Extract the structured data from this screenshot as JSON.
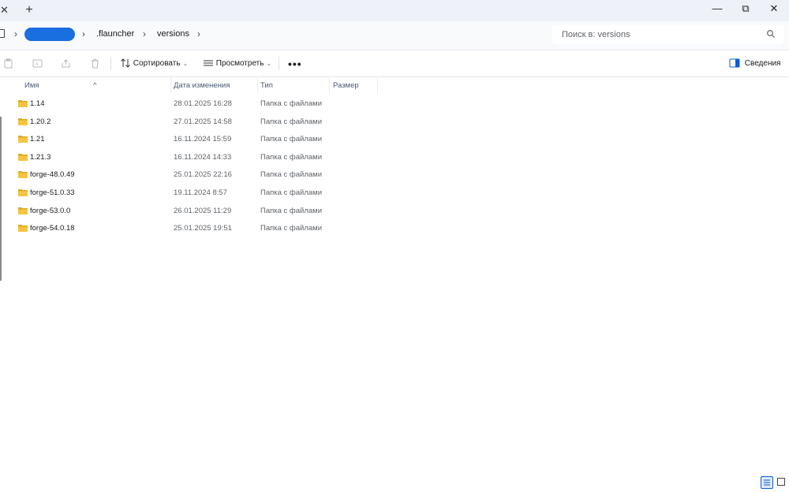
{
  "titlebar": {
    "tab_close": "✕",
    "new_tab": "+",
    "minimize": "—",
    "restore": "⧉",
    "close": "✕"
  },
  "address": {
    "breadcrumbs": [
      ".flauncher",
      "versions"
    ],
    "search_placeholder": "Поиск в: versions"
  },
  "toolbar": {
    "sort_label": "Сортировать",
    "view_label": "Просмотреть",
    "more_label": "•••",
    "details_label": "Сведения"
  },
  "columns": {
    "name": "Имя",
    "date": "Дата изменения",
    "type": "Тип",
    "size": "Размер"
  },
  "files": [
    {
      "name": "1.14",
      "date": "28.01.2025 16:28",
      "type": "Папка с файлами"
    },
    {
      "name": "1.20.2",
      "date": "27.01.2025 14:58",
      "type": "Папка с файлами"
    },
    {
      "name": "1.21",
      "date": "16.11.2024 15:59",
      "type": "Папка с файлами"
    },
    {
      "name": "1.21.3",
      "date": "16.11.2024 14:33",
      "type": "Папка с файлами"
    },
    {
      "name": "forge-48.0.49",
      "date": "25.01.2025 22:16",
      "type": "Папка с файлами"
    },
    {
      "name": "forge-51.0.33",
      "date": "19.11.2024 8:57",
      "type": "Папка с файлами"
    },
    {
      "name": "forge-53.0.0",
      "date": "26.01.2025 11:29",
      "type": "Папка с файлами"
    },
    {
      "name": "forge-54.0.18",
      "date": "25.01.2025 19:51",
      "type": "Папка с файлами"
    }
  ],
  "colors": {
    "accent": "#0b5cd5",
    "folder": "#f4c542",
    "folder_dark": "#e0a820"
  }
}
